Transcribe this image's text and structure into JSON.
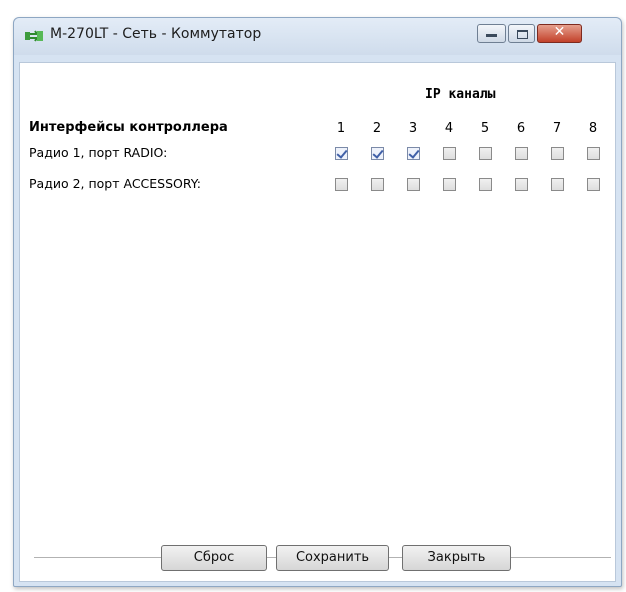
{
  "window": {
    "title": "M-270LT - Сеть - Коммутатор",
    "icon": "network-switch-icon",
    "controls": [
      "minimize",
      "maximize",
      "close"
    ],
    "accent_color": "#c2412a"
  },
  "main": {
    "ip_header": "IP каналы",
    "interfaces_header": "Интерфейсы контроллера",
    "channels": [
      "1",
      "2",
      "3",
      "4",
      "5",
      "6",
      "7",
      "8"
    ],
    "rows": [
      {
        "label": "Радио 1, порт RADIO:",
        "checked": [
          true,
          true,
          true,
          false,
          false,
          false,
          false,
          false
        ]
      },
      {
        "label": "Радио 2, порт ACCESSORY:",
        "checked": [
          false,
          false,
          false,
          false,
          false,
          false,
          false,
          false
        ]
      }
    ]
  },
  "footer": {
    "reset_label": "Сброс",
    "save_label": "Сохранить",
    "close_label": "Закрыть"
  }
}
